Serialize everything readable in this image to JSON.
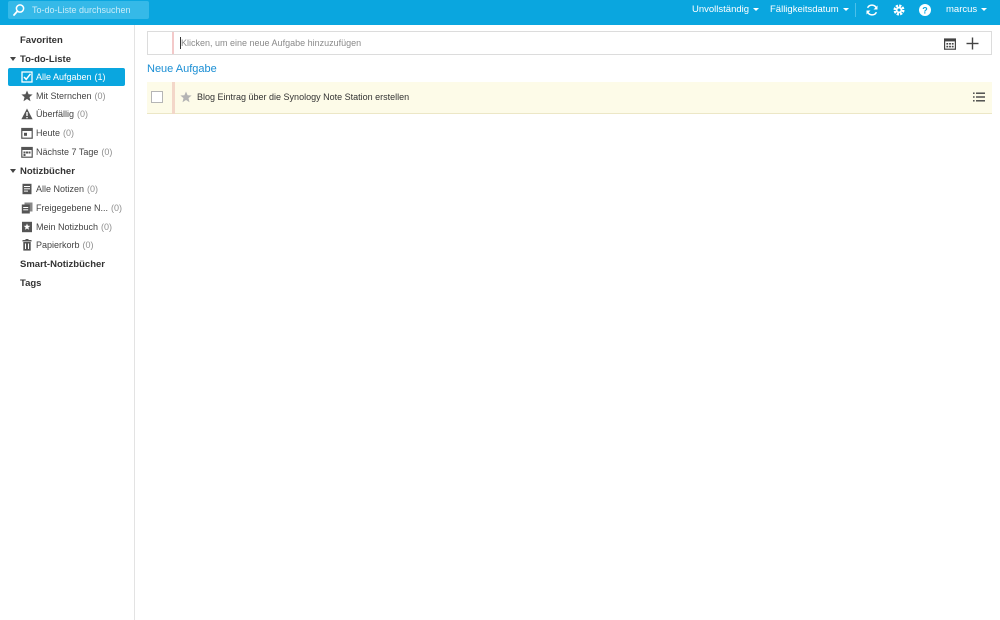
{
  "search": {
    "placeholder": "To-do-Liste durchsuchen",
    "icon": "search-icon"
  },
  "toolbar": {
    "filter_label": "Unvollständig",
    "sort_label": "Fälligkeitsdatum",
    "user_label": "marcus",
    "icons": [
      "refresh-icon",
      "gear-icon",
      "help-icon"
    ]
  },
  "sidebar": {
    "favorites": "Favoriten",
    "todo_title": "To-do-Liste",
    "todo_items": [
      {
        "label": "Alle Aufgaben",
        "count": "(1)",
        "icon": "checkbox-icon"
      },
      {
        "label": "Mit Sternchen",
        "count": "(0)",
        "icon": "star-icon"
      },
      {
        "label": "Überfällig",
        "count": "(0)",
        "icon": "warning-icon"
      },
      {
        "label": "Heute",
        "count": "(0)",
        "icon": "calendar-today-icon"
      },
      {
        "label": "Nächste 7 Tage",
        "count": "(0)",
        "icon": "calendar-week-icon"
      }
    ],
    "notebooks_title": "Notizbücher",
    "notebook_items": [
      {
        "label": "Alle Notizen",
        "count": "(0)",
        "icon": "notes-icon"
      },
      {
        "label": "Freigegebene N...",
        "count": "(0)",
        "icon": "shared-notes-icon"
      },
      {
        "label": "Mein Notizbuch",
        "count": "(0)",
        "icon": "notebook-icon"
      },
      {
        "label": "Papierkorb",
        "count": "(0)",
        "icon": "trash-icon"
      }
    ],
    "smart_title": "Smart-Notizbücher",
    "tags_title": "Tags"
  },
  "main": {
    "add_placeholder": "Klicken, um eine neue Aufgabe hinzuzufügen",
    "group_title": "Neue Aufgabe",
    "tasks": [
      {
        "title": "Blog Eintrag über die Synology Note Station erstellen",
        "starred": false
      }
    ]
  },
  "colors": {
    "accent": "#0aa6df",
    "task_bg": "#fdfbe8",
    "group_title": "#1a8ed4"
  }
}
